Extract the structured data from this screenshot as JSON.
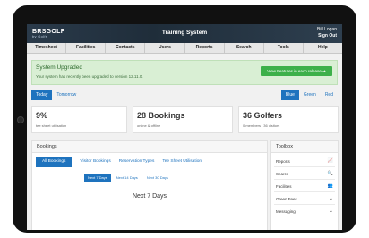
{
  "header": {
    "logo_main": "BRSGOLF",
    "logo_sub": "by Golfs",
    "title": "Training System",
    "user_name": "Bill Logan",
    "sign_out": "Sign Out"
  },
  "nav": [
    "Timesheet",
    "Facilities",
    "Contacts",
    "Users",
    "Reports",
    "Search",
    "Tools",
    "Help"
  ],
  "alert": {
    "title": "System Upgraded",
    "message": "Your system has recently been upgraded to version 12.11.0.",
    "button": "View Features in each release"
  },
  "day_tabs": [
    "Today",
    "Tomorrow"
  ],
  "color_tabs": [
    "Blue",
    "Green",
    "Red"
  ],
  "stats": [
    {
      "value": "9%",
      "label": "tee sheet utilisation"
    },
    {
      "value": "28 Bookings",
      "label": "online & offline"
    },
    {
      "value": "36 Golfers",
      "label": "0 members | 36 visitors"
    }
  ],
  "bookings": {
    "title": "Bookings",
    "tabs": [
      "All Bookings",
      "Visitor Bookings",
      "Reservation Types",
      "Tee Sheet Utilisation"
    ],
    "sub_tabs": [
      "Next 7 Days",
      "Next 14 Days",
      "Next 30 Days"
    ],
    "heading": "Next 7 Days"
  },
  "toolbox": {
    "title": "Toolbox",
    "items": [
      {
        "label": "Reports",
        "icon": "chart-icon",
        "glyph": "📈"
      },
      {
        "label": "Search",
        "icon": "search-icon",
        "glyph": "🔍"
      },
      {
        "label": "Facilities",
        "icon": "users-icon",
        "glyph": "👥"
      },
      {
        "label": "Green Fees",
        "icon": "chevron-down-icon",
        "glyph": "⌄"
      },
      {
        "label": "Messaging",
        "icon": "chevron-down-icon",
        "glyph": "⌄"
      }
    ]
  },
  "colors": {
    "accent": "#1e73be",
    "alert_bg": "#d9efd4",
    "alert_button": "#3db04a",
    "header_bg": "#1f2d3a"
  }
}
